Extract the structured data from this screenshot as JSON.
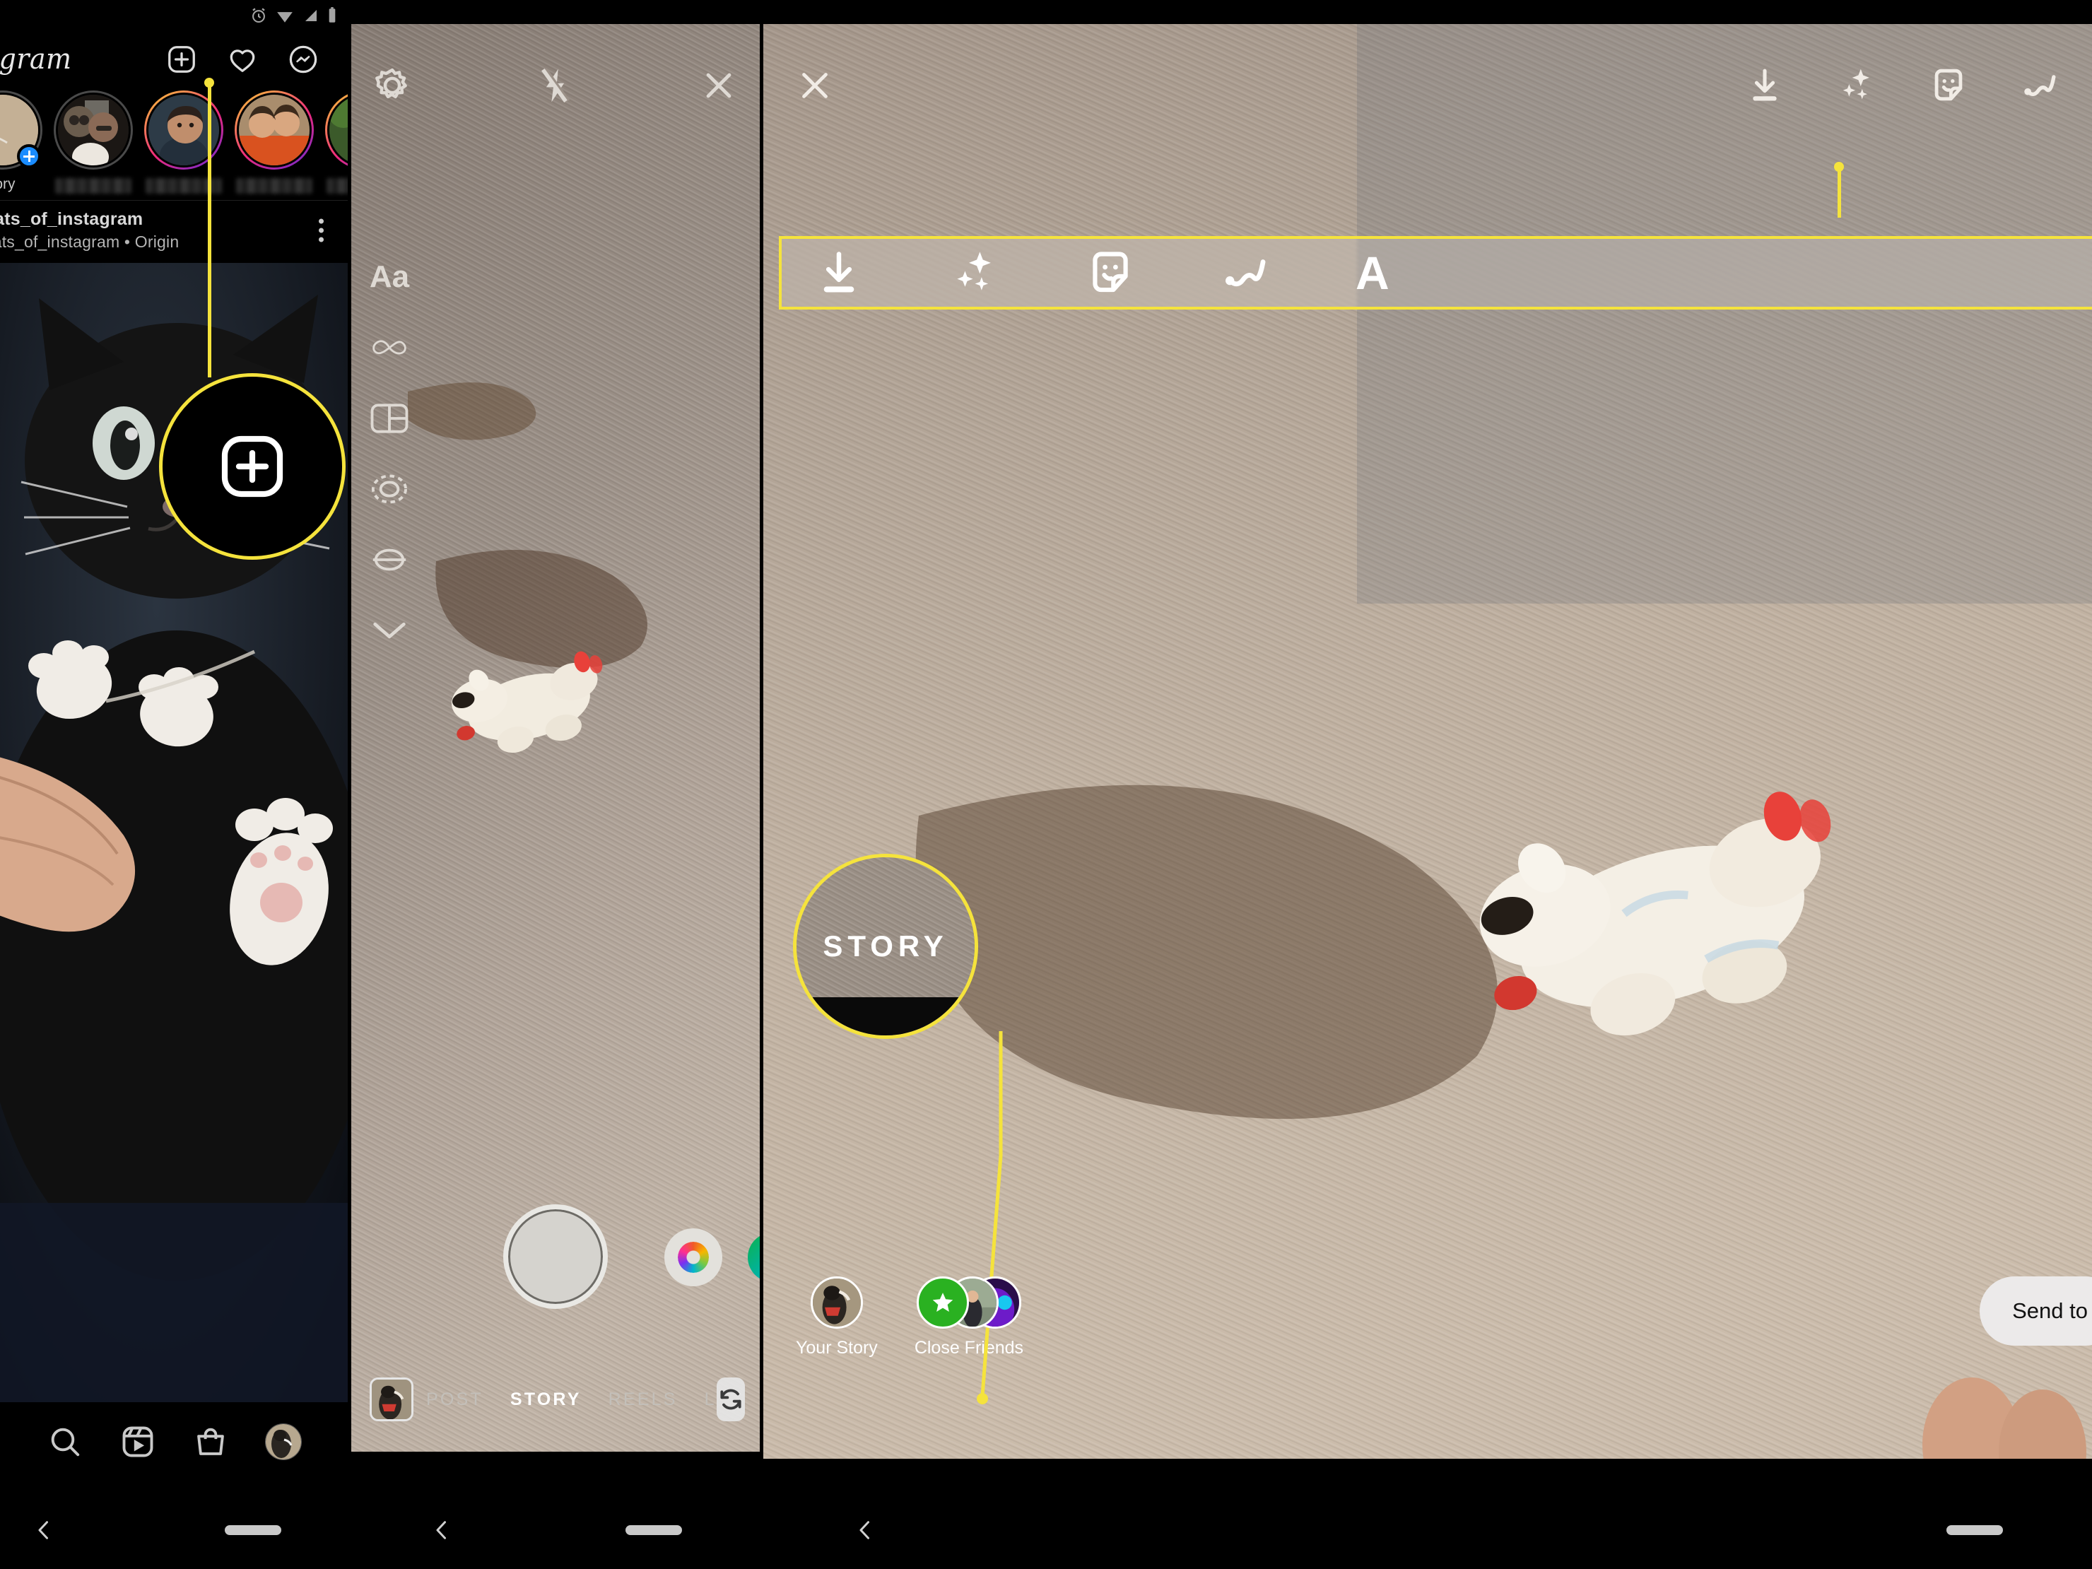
{
  "meta": {
    "accent_yellow": "#f5e33c",
    "panels": [
      "instagram-feed",
      "instagram-story-camera",
      "instagram-story-editor"
    ]
  },
  "panel_feed": {
    "statusbar": {
      "icons": [
        "alarm-icon",
        "wifi-icon",
        "signal-icon",
        "battery-icon"
      ]
    },
    "header": {
      "logo_text": "agram",
      "icons": [
        "add-post-icon",
        "heart-icon",
        "messenger-icon"
      ]
    },
    "stories": [
      {
        "name": "tory",
        "ring": "own",
        "has_plus": true
      },
      {
        "name": "",
        "ring": "seen",
        "has_plus": false
      },
      {
        "name": "",
        "ring": "unseen",
        "has_plus": false
      },
      {
        "name": "",
        "ring": "unseen",
        "has_plus": false
      },
      {
        "name": "",
        "ring": "unseen",
        "has_plus": false
      }
    ],
    "post": {
      "username": "cats_of_instagram",
      "subtitle": "cats_of_instagram • Origin",
      "menu_icon": "more-options-icon"
    },
    "bottom_nav": [
      "search-icon",
      "reels-icon",
      "shop-icon",
      "profile-avatar"
    ],
    "system_nav": [
      "back-icon",
      "home-pill"
    ]
  },
  "panel_camera": {
    "top_icons": [
      "settings-gear-icon",
      "flash-off-icon",
      "close-icon"
    ],
    "side_tools": [
      {
        "icon": "text-aa-icon",
        "label": "Aa"
      },
      {
        "icon": "boomerang-infinity-icon",
        "label": ""
      },
      {
        "icon": "layout-grid-icon",
        "label": ""
      },
      {
        "icon": "superzoom-dashed-icon",
        "label": ""
      },
      {
        "icon": "hands-free-icon",
        "label": ""
      },
      {
        "icon": "chevron-down-icon",
        "label": ""
      }
    ],
    "controls": {
      "shutter": "capture-button",
      "effects": "effects-button",
      "gallery": "gallery-avatar-button"
    },
    "bottom": {
      "thumbnail": "last-photo-thumbnail",
      "modes": [
        "POST",
        "STORY",
        "REELS",
        "L"
      ],
      "active_mode": "STORY",
      "flip_icon": "flip-camera-icon"
    }
  },
  "panel_editor": {
    "top_icons": [
      "close-icon",
      "download-icon",
      "effects-sparkle-icon",
      "sticker-icon",
      "draw-squiggle-icon"
    ],
    "highlighted_toolbar": [
      {
        "icon": "download-icon",
        "label": ""
      },
      {
        "icon": "effects-sparkle-icon",
        "label": ""
      },
      {
        "icon": "sticker-icon",
        "label": ""
      },
      {
        "icon": "draw-squiggle-icon",
        "label": ""
      },
      {
        "icon": "text-aa-icon",
        "label": "A"
      }
    ],
    "audience": [
      {
        "label": "Your Story",
        "avatar": "dog-avatar"
      },
      {
        "label": "Close Friends",
        "avatar": "close-friends-star"
      }
    ],
    "send_button": "Send to",
    "system_nav": [
      "back-icon",
      "home-pill"
    ]
  },
  "annotations": {
    "plus_callout": {
      "icon": "add-post-icon",
      "target": "header add button"
    },
    "story_callout": {
      "text": "STORY",
      "target": "story mode tab"
    },
    "toolbar_callout": {
      "target": "editor toolbar"
    }
  }
}
